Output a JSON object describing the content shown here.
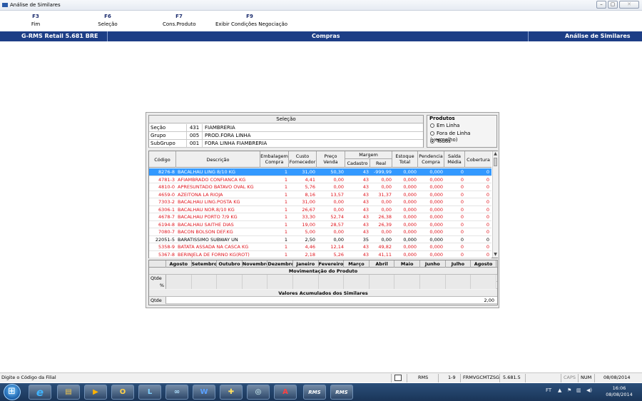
{
  "window": {
    "title": "Análise de Similares",
    "min": "–",
    "max": "▢",
    "close": "✕"
  },
  "fkeys": [
    {
      "key": "F3",
      "label": "Fim"
    },
    {
      "key": "F6",
      "label": "Seleção"
    },
    {
      "key": "F7",
      "label": "Cons.Produto"
    },
    {
      "key": "F9",
      "label": "Exibir Condições Negociação"
    }
  ],
  "header": {
    "left": "G-RMS Retail 5.681 BRE",
    "center": "Compras",
    "right": "Análise de Similares"
  },
  "selecao": {
    "title": "Seleção",
    "rows": [
      {
        "label": "Seção",
        "code": "431",
        "desc": "FIAMBRERIA"
      },
      {
        "label": "Grupo",
        "code": "005",
        "desc": "PROD.FORA LINHA"
      },
      {
        "label": "SubGrupo",
        "code": "001",
        "desc": "FORA LINHA FIAMBRERIA"
      }
    ]
  },
  "produtos": {
    "title": "Produtos",
    "options": [
      {
        "label": "Em Linha",
        "checked": false
      },
      {
        "label": "Fora de Linha (vermelho)",
        "checked": false
      },
      {
        "label": "Todos",
        "checked": true
      }
    ]
  },
  "grid": {
    "headers": {
      "codigo": "Código",
      "descricao": "Descrição",
      "embalagem": [
        "Embalagem",
        "Compra"
      ],
      "custo": [
        "Custo",
        "Fornecedor"
      ],
      "preco": [
        "Preço",
        "Venda"
      ],
      "margem": "Margem",
      "cadastro": "Cadastro",
      "real": "Real",
      "estoque": [
        "Estoque",
        "Total"
      ],
      "pendencia": [
        "Pendencia",
        "Compra"
      ],
      "saida": [
        "Saída",
        "Média"
      ],
      "cobertura": "Cobertura"
    },
    "rows": [
      [
        "8276-8",
        "BACALHAU LING 8/10 KG",
        "1",
        "31,00",
        "50,30",
        "43",
        "-999,99",
        "0,000",
        "0,000",
        "0",
        "0"
      ],
      [
        "4781-3",
        "AFIAMBRADO CONFIANCA KG",
        "1",
        "4,41",
        "0,00",
        "43",
        "0,00",
        "0,000",
        "0,000",
        "0",
        "0"
      ],
      [
        "4810-0",
        "APRESUNTADO BATAVO OVAL KG",
        "1",
        "5,76",
        "0,00",
        "43",
        "0,00",
        "0,000",
        "0,000",
        "0",
        "0"
      ],
      [
        "4659-0",
        "AZEITONA LA RIOJA",
        "1",
        "8,16",
        "13,57",
        "43",
        "31,37",
        "0,000",
        "0,000",
        "0",
        "0"
      ],
      [
        "7303-2",
        "BACALHAU LING.POSTA KG",
        "1",
        "31,00",
        "0,00",
        "43",
        "0,00",
        "0,000",
        "0,000",
        "0",
        "0"
      ],
      [
        "6306-1",
        "BACALHAU NOR.8/10 KG",
        "1",
        "26,67",
        "0,00",
        "43",
        "0,00",
        "0,000",
        "0,000",
        "0",
        "0"
      ],
      [
        "4678-7",
        "BACALHAU PORTO 7/9 KG",
        "1",
        "33,30",
        "52,74",
        "43",
        "26,38",
        "0,000",
        "0,000",
        "0",
        "0"
      ],
      [
        "6194-8",
        "BACALHAU SAITHE DIAS",
        "1",
        "19,00",
        "28,57",
        "43",
        "26,39",
        "0,000",
        "0,000",
        "0",
        "0"
      ],
      [
        "7080-7",
        "BACON BOLSON DEF.KG",
        "1",
        "5,00",
        "0,00",
        "43",
        "0,00",
        "0,000",
        "0,000",
        "0",
        "0"
      ],
      [
        "22051-5",
        "BARATISSIMO SUBWAY UN",
        "1",
        "2,50",
        "0,00",
        "35",
        "0,00",
        "0,000",
        "0,000",
        "0",
        "0"
      ],
      [
        "5358-9",
        "BATATA ASSADA NA CASCA KG",
        "1",
        "4,46",
        "12,14",
        "43",
        "49,82",
        "0,000",
        "0,000",
        "0",
        "0"
      ],
      [
        "5367-8",
        "BERINJELA DE FORNO KG(ROT)",
        "1",
        "2,18",
        "5,26",
        "43",
        "41,11",
        "0,000",
        "0,000",
        "0",
        "0"
      ]
    ]
  },
  "months": {
    "labels": [
      "Agosto",
      "Setembro",
      "Outubro",
      "Novembro",
      "Dezembro",
      "Janeiro",
      "Fevereiro",
      "Março",
      "Abril",
      "Maio",
      "Junho",
      "Julho",
      "Agosto"
    ],
    "mov_title": "Movimentação do Produto",
    "qtde": "Qtde",
    "pct": "%",
    "acum_title": "Valores Acumulados dos Similares",
    "acum_total": "2,00"
  },
  "status": {
    "hint": "Digite o Código da Filial",
    "rms": "RMS",
    "pos": "1-9",
    "terminal": "FRMVGCMTZSG",
    "version": "5.681.5",
    "caps": "CAPS",
    "num": "NUM",
    "date": "08/08/2014"
  },
  "taskbar": {
    "rms1": "RMS",
    "rms2": "RMS",
    "lang": "FT",
    "time": "16:06",
    "date": "08/08/2014"
  }
}
